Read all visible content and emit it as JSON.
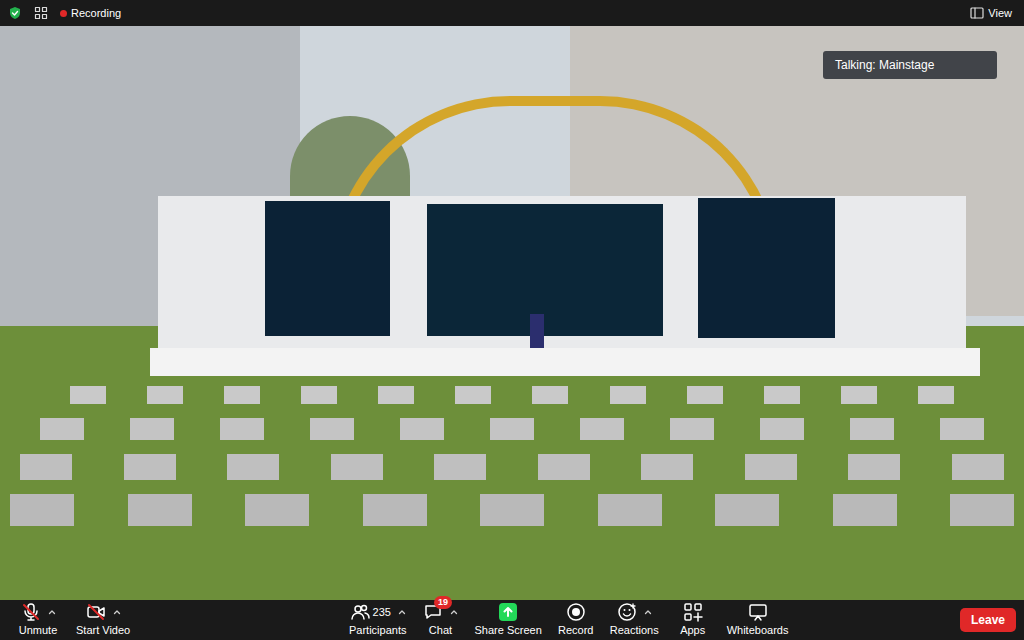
{
  "top_bar": {
    "recording": {
      "label": "Recording",
      "on": true
    },
    "view": "View"
  },
  "talking": "Talking: Mainstage",
  "toolbar": [
    {
      "label": "Unmute",
      "kind": "mic",
      "off": true,
      "menu": true
    },
    {
      "label": "Start Video",
      "kind": "video",
      "off": true,
      "menu": true
    },
    {
      "label": "Participants",
      "kind": "participants",
      "count": "235",
      "off": false,
      "menu": true
    },
    {
      "label": "Chat",
      "kind": "chat",
      "badge": "19",
      "off": false,
      "menu": true
    },
    {
      "label": "Share Screen",
      "kind": "share",
      "off": false,
      "menu": false
    },
    {
      "label": "Record",
      "kind": "record",
      "off": false,
      "menu": false
    },
    {
      "label": "Reactions",
      "kind": "reactions",
      "off": false,
      "menu": true
    },
    {
      "label": "Apps",
      "kind": "apps",
      "off": false,
      "menu": false
    },
    {
      "label": "Whiteboards",
      "kind": "whiteboards",
      "off": false,
      "menu": false
    }
  ],
  "leave": "Leave"
}
